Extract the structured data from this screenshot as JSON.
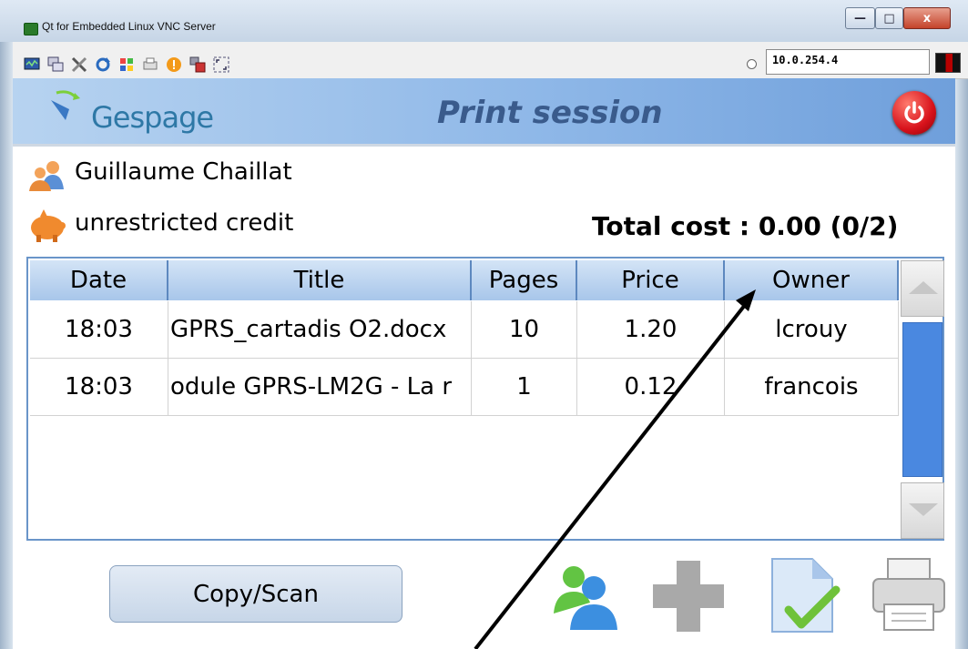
{
  "window": {
    "title": "Qt for Embedded Linux VNC Server",
    "controls": {
      "minimize": "—",
      "maximize": "□",
      "close": "x"
    }
  },
  "toolbar": {
    "icons": [
      "monitor-icon",
      "copy-windows-icon",
      "tools-icon",
      "refresh-icon",
      "windows-logo-icon",
      "printer-small-icon",
      "alert-icon",
      "disconnect-icon",
      "fullscreen-icon"
    ],
    "ip_address": "10.0.254.4"
  },
  "banner": {
    "logo_text": "Gespage",
    "title": "Print session",
    "power_color": "#d8121b"
  },
  "session": {
    "user_name": "Guillaume Chaillat",
    "credit": "unrestricted credit",
    "total": "Total cost : 0.00  (0/2)"
  },
  "table": {
    "columns": [
      "Date",
      "Title",
      "Pages",
      "Price",
      "Owner"
    ],
    "rows": [
      [
        "18:03",
        "GPRS_cartadis O2.docx",
        "10",
        "1.20",
        "lcrouy"
      ],
      [
        "18:03",
        "odule GPRS-LM2G - La r",
        "1",
        "0.12",
        "francois"
      ]
    ],
    "scroll_thumb_color": "#4a88e0"
  },
  "actions": {
    "copy_scan_label": "Copy/Scan",
    "icons": [
      "users-icon",
      "add-icon",
      "validate-document-icon",
      "printer-icon"
    ]
  }
}
